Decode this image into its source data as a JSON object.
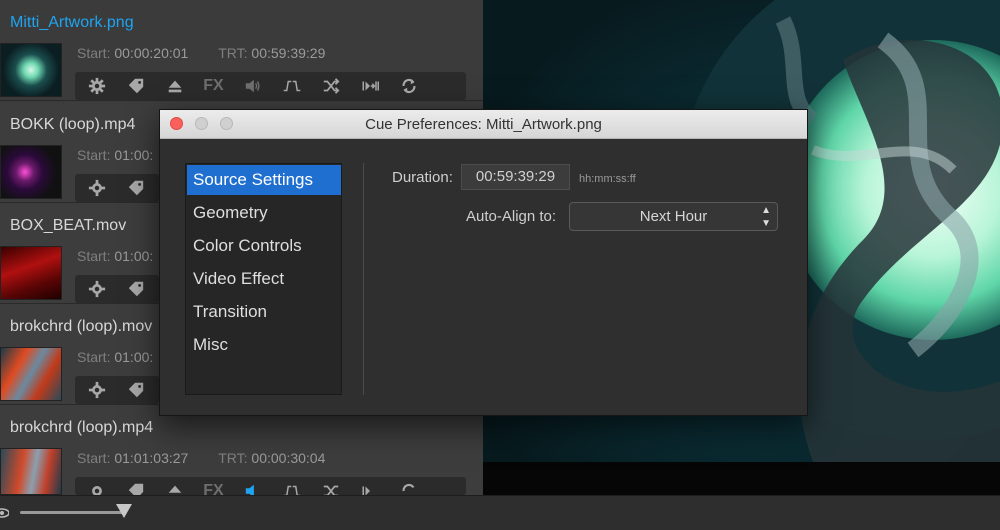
{
  "cues": [
    {
      "name": "Mitti_Artwork.png",
      "start_label": "Start:",
      "start": "00:00:20:01",
      "trt_label": "TRT:",
      "trt": "00:59:39:29",
      "selected": true
    },
    {
      "name": "BOKK (loop).mp4",
      "start_label": "Start:",
      "start": "01:00:",
      "trt_label": "",
      "trt": ""
    },
    {
      "name": "BOX_BEAT.mov",
      "start_label": "Start:",
      "start": "01:00:",
      "trt_label": "",
      "trt": ""
    },
    {
      "name": "brokchrd (loop).mov",
      "start_label": "Start:",
      "start": "01:00:",
      "trt_label": "",
      "trt": ""
    },
    {
      "name": "brokchrd (loop).mp4",
      "start_label": "Start:",
      "start": "01:01:03:27",
      "trt_label": "TRT:",
      "trt": "00:00:30:04"
    }
  ],
  "toolbar": {
    "fx_label": "FX",
    "icons": [
      "gear-icon",
      "tag-icon",
      "eject-icon",
      "fx-icon",
      "volume-icon",
      "fade-icon",
      "shuffle-icon",
      "skip-icon",
      "loop-icon"
    ]
  },
  "dialog": {
    "title": "Cue Preferences: Mitti_Artwork.png",
    "categories": [
      "Source Settings",
      "Geometry",
      "Color Controls",
      "Video Effect",
      "Transition",
      "Misc"
    ],
    "selected_category": "Source Settings",
    "duration_label": "Duration:",
    "duration_value": "00:59:39:29",
    "duration_hint": "hh:mm:ss:ff",
    "align_label": "Auto-Align to:",
    "align_value": "Next Hour"
  },
  "colors": {
    "accent": "#1ea4f0",
    "selection": "#1f6fd0",
    "close_light": "#fc605c"
  },
  "bottom_bar": {
    "icon": "eye-icon",
    "level": 0.95
  }
}
